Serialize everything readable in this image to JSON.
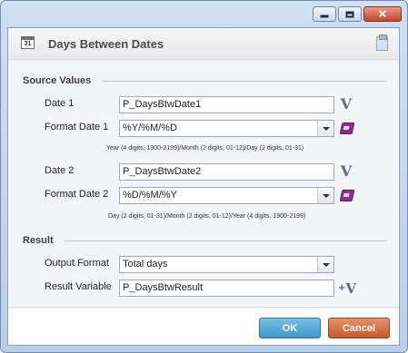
{
  "window": {
    "controls": {
      "minimize": "minimize-icon",
      "maximize": "maximize-icon",
      "close": "close-icon",
      "close_glyph": "✕"
    }
  },
  "header": {
    "title": "Days Between Dates",
    "cal_glyph": "31"
  },
  "source_values": {
    "heading": "Source Values",
    "date1": {
      "label": "Date 1",
      "value": "P_DaysBtwDate1",
      "var_glyph": "V"
    },
    "format1": {
      "label": "Format Date 1",
      "value": "%Y/%M/%D",
      "hint": "Year (4 digits, 1900-2199)/Month (2 digits, 01-12)/Day (2 digits, 01-31)"
    },
    "date2": {
      "label": "Date 2",
      "value": "P_DaysBtwDate2",
      "var_glyph": "V"
    },
    "format2": {
      "label": "Format Date 2",
      "value": "%D/%M/%Y",
      "hint": "Day (2 digits, 01-31)/Month (2 digits, 01-12)/Year (4 digits, 1900-2199)"
    }
  },
  "result": {
    "heading": "Result",
    "output_format": {
      "label": "Output Format",
      "value": "Total days"
    },
    "result_variable": {
      "label": "Result Variable",
      "value": "P_DaysBtwResult",
      "var_glyph": "V",
      "plus_glyph": "+"
    }
  },
  "footer": {
    "ok": "OK",
    "cancel": "Cancel"
  },
  "colors": {
    "ok": "#3f97c8",
    "cancel": "#c5592b",
    "book": "#8e2e8a"
  }
}
